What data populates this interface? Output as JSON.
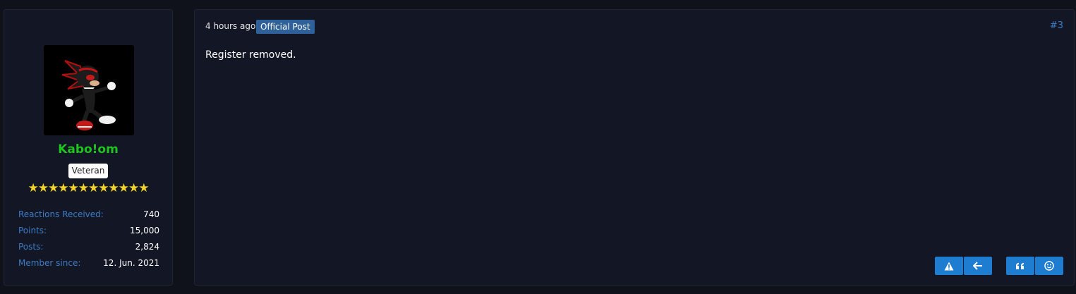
{
  "author": {
    "username": "Kabo!om",
    "rank": "Veteran",
    "stars": "★★★★★★★★★★★★",
    "stats": [
      {
        "label": "Reactions Received:",
        "value": "740"
      },
      {
        "label": "Points:",
        "value": "15,000"
      },
      {
        "label": "Posts:",
        "value": "2,824"
      },
      {
        "label": "Member since:",
        "value": "12. Jun. 2021"
      }
    ]
  },
  "post": {
    "time": "4 hours ago",
    "badge": "Official Post",
    "number": "#3",
    "body": "Register removed."
  },
  "actions": {
    "report_icon": "warning-icon",
    "reply_icon": "arrow-left-icon",
    "quote_icon": "quote-icon",
    "react_icon": "smile-icon"
  },
  "colors": {
    "background": "#0f121b",
    "panel": "#131725",
    "username": "#1fc41f",
    "link": "#3d7cc4",
    "button": "#1e7dd1",
    "badge": "#2e6199"
  }
}
